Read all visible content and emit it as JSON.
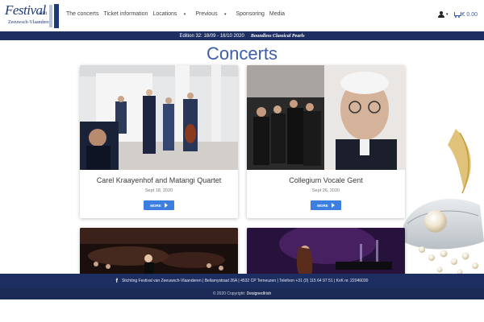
{
  "brand": {
    "logo_line1": "Festival",
    "logo_line1b": "van",
    "logo_line2": "Zeeuwsch-Vlaanderen"
  },
  "nav": {
    "items": [
      {
        "label": "The concerts",
        "dropdown": false
      },
      {
        "label": "Ticket information",
        "dropdown": false
      },
      {
        "label": "Locations",
        "dropdown": true
      },
      {
        "label": "Previous",
        "dropdown": true
      },
      {
        "label": "Sponsoring",
        "dropdown": false
      },
      {
        "label": "Media",
        "dropdown": false
      }
    ],
    "cart_total": "€ 0.00"
  },
  "edition": {
    "text": "Edition 32: 18/09 - 16/10 2020",
    "tagline": "Boundless Classical Pearls"
  },
  "main": {
    "title": "Concerts",
    "cards": [
      {
        "title": "Carel Kraayenhof and Matangi Quartet",
        "date": "Sept 18, 2020",
        "button": "MORE"
      },
      {
        "title": "Collegium Vocale Gent",
        "date": "Sept 26, 2020",
        "button": "MORE"
      },
      {
        "title": "",
        "date": "",
        "button": ""
      },
      {
        "title": "",
        "date": "",
        "button": ""
      }
    ]
  },
  "footer": {
    "info": "Stichting Festival van Zeeuwsch-Vlaanderen | Bellamystraat 26A | 4532 CP Terneuzen | Telefoon +31 (0) 115 64 97 51 | KvK nr. 22046030",
    "copyright_prefix": "© 2020 Copyright:",
    "copyright_link": "DesignedIrish"
  },
  "colors": {
    "navy": "#1d2f62",
    "accent_blue": "#3c7fe0",
    "title_blue": "#3e5ea8"
  }
}
